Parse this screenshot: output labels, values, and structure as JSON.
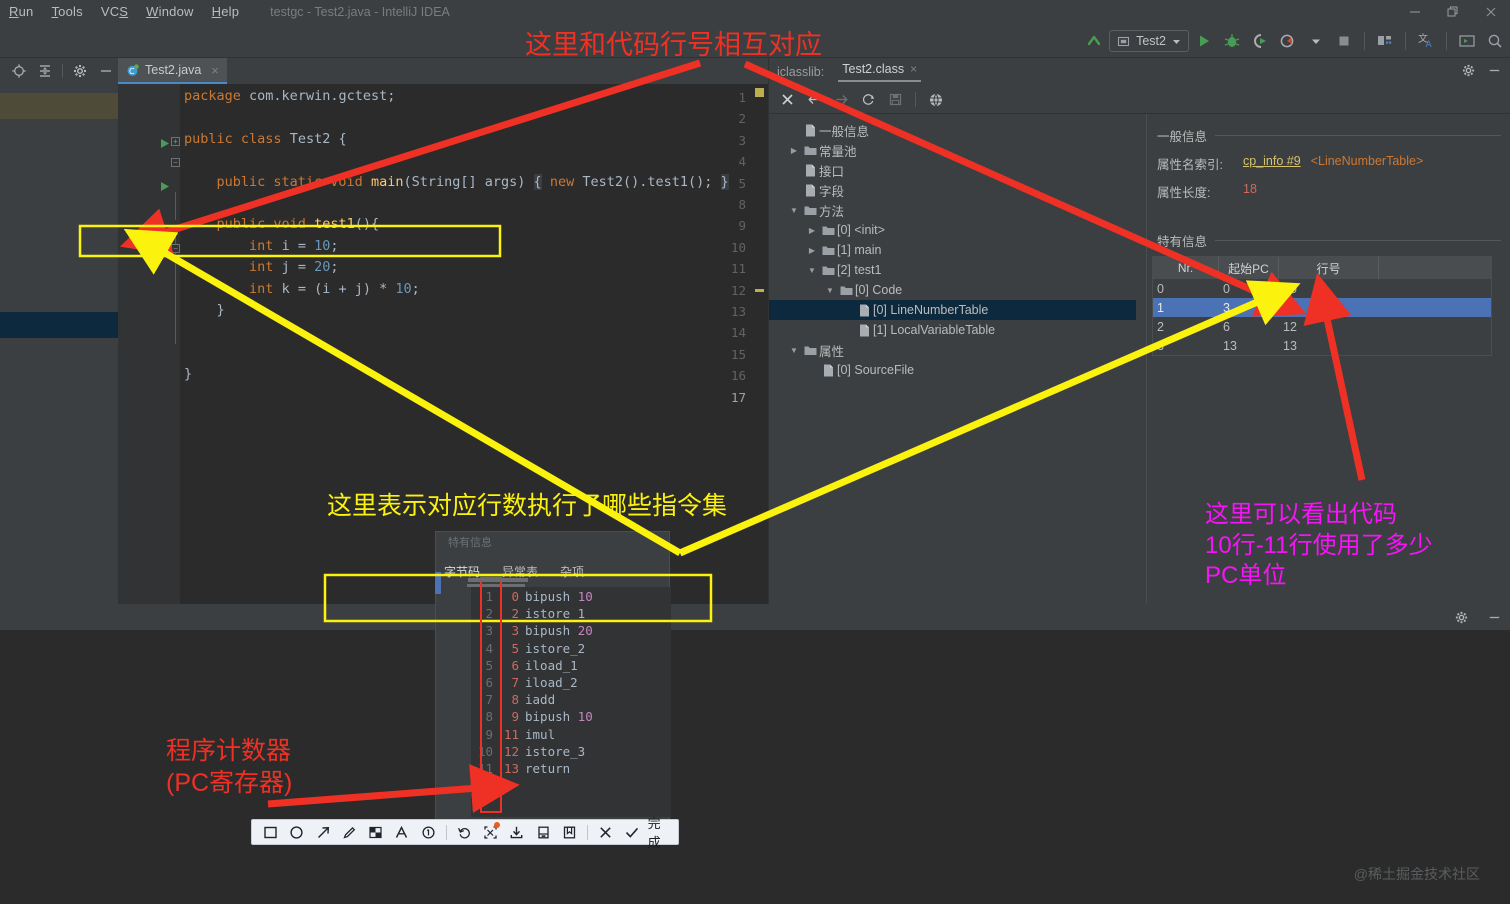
{
  "window": {
    "title": "testgc - Test2.java - IntelliJ IDEA",
    "menus": [
      "Run",
      "Tools",
      "VCS",
      "Window",
      "Help"
    ],
    "controls": [
      "minimize-icon",
      "restore-icon",
      "close-icon"
    ]
  },
  "toolbar": {
    "run_config": "Test2",
    "icons": [
      "build-icon",
      "run-icon",
      "debug-icon",
      "run-coverage-icon",
      "profiler-icon",
      "stop-icon",
      "project-structure-icon",
      "translate-icon",
      "terminal-icon",
      "search-icon"
    ]
  },
  "left_strip": {
    "icons": [
      "locate-icon",
      "collapse-all-icon",
      "settings-icon",
      "hide-icon"
    ]
  },
  "editor": {
    "tab": {
      "label": "Test2.java",
      "icon": "java-class-icon",
      "close": "×"
    },
    "gutter_lines": [
      "1",
      "2",
      "3",
      "4",
      "5",
      "8",
      "9",
      "10",
      "11",
      "12",
      "13",
      "14",
      "15",
      "16",
      "17"
    ],
    "current_line": "17",
    "run_markers": [
      "3",
      "5"
    ],
    "code": [
      {
        "line": "1",
        "html": "<span class=\"k\">package</span> <span class=\"t\">com.kerwin.gctest;</span>"
      },
      {
        "line": "3",
        "html": "<span class=\"k\">public class</span> <span class=\"t\">Test2 {</span>"
      },
      {
        "line": "5",
        "html": "    <span class=\"k\">public static void</span> <span class=\"fn\">main</span><span class=\"t\">(String[] args) </span><span class=\"hl t\">{</span><span class=\"t\"> </span><span class=\"k\">new</span><span class=\"t\"> Test2().test1(); </span><span class=\"hl t\">}</span>"
      },
      {
        "line": "9",
        "html": "    <span class=\"k\">public void</span> <span class=\"fn\">test1</span><span class=\"t\">(){</span>"
      },
      {
        "line": "10",
        "html": "        <span class=\"k\">int</span> <span class=\"t\">i = </span><span class=\"n\">10</span><span class=\"t\">;</span>"
      },
      {
        "line": "11",
        "html": "        <span class=\"k\">int</span> <span class=\"t\">j = </span><span class=\"n\">20</span><span class=\"t\">;</span>"
      },
      {
        "line": "12",
        "html": "        <span class=\"k\">int</span> <span class=\"t\">k = (i + j) * </span><span class=\"n\">10</span><span class=\"t\">;</span>"
      },
      {
        "line": "13",
        "html": "    <span class=\"t\">}</span>"
      },
      {
        "line": "16",
        "html": "<span class=\"t\">}</span>"
      }
    ]
  },
  "jclasslib": {
    "panel_label": "jclasslib:",
    "tab": {
      "label": "Test2.class",
      "close": "×"
    },
    "toolbar_icons": [
      "close-icon",
      "back-icon",
      "forward-icon",
      "reload-icon",
      "save-icon",
      "browse-icon"
    ],
    "tree": [
      {
        "indent": 1,
        "twist": "",
        "icon": "leaf-icon",
        "label": "一般信息",
        "selected": false
      },
      {
        "indent": 1,
        "twist": "▶",
        "icon": "folder-icon",
        "label": "常量池",
        "selected": false
      },
      {
        "indent": 1,
        "twist": "",
        "icon": "leaf-icon",
        "label": "接口",
        "selected": false
      },
      {
        "indent": 1,
        "twist": "",
        "icon": "leaf-icon",
        "label": "字段",
        "selected": false
      },
      {
        "indent": 1,
        "twist": "▼",
        "icon": "folder-icon",
        "label": "方法",
        "selected": false
      },
      {
        "indent": 2,
        "twist": "▶",
        "icon": "folder-icon",
        "label": "[0] <init>",
        "selected": false
      },
      {
        "indent": 2,
        "twist": "▶",
        "icon": "folder-icon",
        "label": "[1] main",
        "selected": false
      },
      {
        "indent": 2,
        "twist": "▼",
        "icon": "folder-icon",
        "label": "[2] test1",
        "selected": false
      },
      {
        "indent": 3,
        "twist": "▼",
        "icon": "folder-icon",
        "label": "[0] Code",
        "selected": false
      },
      {
        "indent": 4,
        "twist": "",
        "icon": "leaf-icon",
        "label": "[0] LineNumberTable",
        "selected": true
      },
      {
        "indent": 4,
        "twist": "",
        "icon": "leaf-icon",
        "label": "[1] LocalVariableTable",
        "selected": false
      },
      {
        "indent": 1,
        "twist": "▼",
        "icon": "folder-icon",
        "label": "属性",
        "selected": false
      },
      {
        "indent": 2,
        "twist": "",
        "icon": "leaf-icon",
        "label": "[0] SourceFile",
        "selected": false
      }
    ],
    "detail": {
      "general_title": "一般信息",
      "attr_name_key": "属性名索引:",
      "attr_name_link": "cp_info #9",
      "attr_name_value": "<LineNumberTable>",
      "attr_len_key": "属性长度:",
      "attr_len_value": "18",
      "specific_title": "特有信息",
      "table": {
        "columns": [
          "Nr.",
          "起始PC",
          "行号"
        ],
        "rows": [
          {
            "nr": "0",
            "pc": "0",
            "line": "10",
            "selected": false
          },
          {
            "nr": "1",
            "pc": "3",
            "line": "11",
            "selected": true
          },
          {
            "nr": "2",
            "pc": "6",
            "line": "12",
            "selected": false
          },
          {
            "nr": "3",
            "pc": "13",
            "line": "13",
            "selected": false
          }
        ]
      }
    }
  },
  "bytecode_panel": {
    "ghost_title": "特有信息",
    "tabs": [
      "字节码",
      "异常表",
      "杂项"
    ],
    "active_tab": "字节码",
    "rows": [
      {
        "no": "1",
        "pc": "0",
        "op": "bipush",
        "arg": "10"
      },
      {
        "no": "2",
        "pc": "2",
        "op": "istore_1",
        "arg": ""
      },
      {
        "no": "3",
        "pc": "3",
        "op": "bipush",
        "arg": "20"
      },
      {
        "no": "4",
        "pc": "5",
        "op": "istore_2",
        "arg": ""
      },
      {
        "no": "5",
        "pc": "6",
        "op": "iload_1",
        "arg": ""
      },
      {
        "no": "6",
        "pc": "7",
        "op": "iload_2",
        "arg": ""
      },
      {
        "no": "7",
        "pc": "8",
        "op": "iadd",
        "arg": ""
      },
      {
        "no": "8",
        "pc": "9",
        "op": "bipush",
        "arg": "10"
      },
      {
        "no": "9",
        "pc": "11",
        "op": "imul",
        "arg": ""
      },
      {
        "no": "10",
        "pc": "12",
        "op": "istore_3",
        "arg": ""
      },
      {
        "no": "11",
        "pc": "13",
        "op": "return",
        "arg": ""
      }
    ]
  },
  "bottom_panel": {
    "icons": [
      "settings-icon",
      "hide-icon"
    ],
    "watermark": "@稀土掘金技术社区"
  },
  "annotation_toolbar": {
    "tools": [
      "rectangle-icon",
      "ellipse-icon",
      "arrow-icon",
      "pen-icon",
      "mosaic-icon",
      "text-icon",
      "step-number-icon",
      "undo-icon",
      "ocr-icon",
      "download-icon",
      "pin-icon",
      "bookmark-icon",
      "cancel-icon",
      "confirm-icon"
    ],
    "done_label": "完成"
  },
  "annotations": {
    "top_red": "这里和代码行号相互对应",
    "mid_yellow": "这里表示对应行数执行了哪些指令集",
    "right_magenta": "这里可以看出代码\n10行-11行使用了多少\nPC单位",
    "bottom_red": "程序计数器\n(PC寄存器)",
    "colors": {
      "red": "#ee3124",
      "yellow": "#fbf20d",
      "magenta": "#f713f7"
    }
  }
}
